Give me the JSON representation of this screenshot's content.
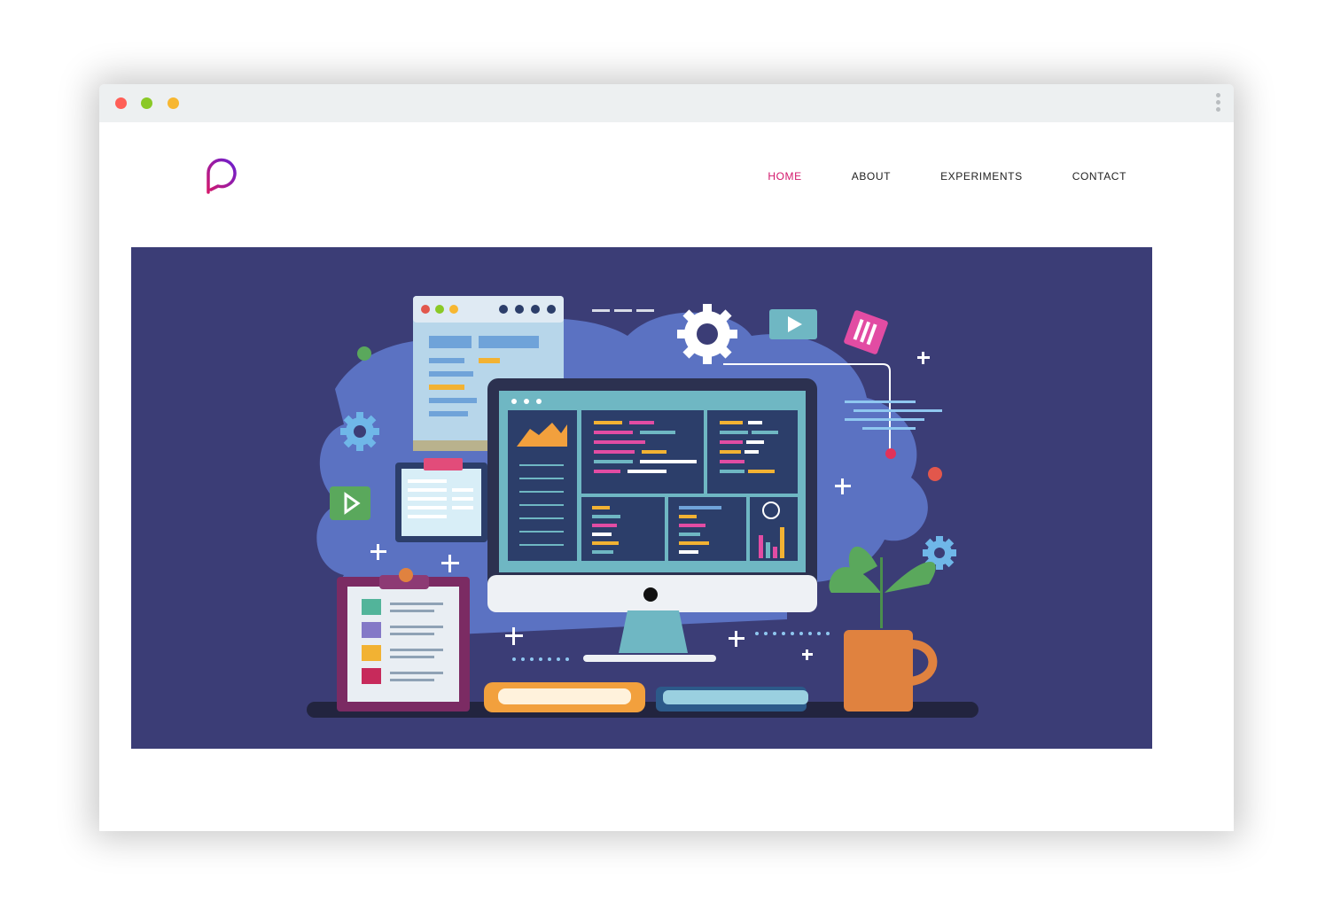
{
  "window": {
    "traffic_lights": {
      "close": "#ff5f57",
      "minimize": "#8ac926",
      "zoom": "#f7b731"
    },
    "menu_icon": "kebab-menu-icon"
  },
  "site": {
    "logo_icon": "speech-bubble-logo-icon",
    "logo_gradient": [
      "#d3186c",
      "#6a1fd1"
    ],
    "nav": [
      {
        "label": "HOME",
        "active": true
      },
      {
        "label": "ABOUT",
        "active": false
      },
      {
        "label": "EXPERIMENTS",
        "active": false
      },
      {
        "label": "CONTACT",
        "active": false
      }
    ],
    "accent": "#d3186c"
  },
  "hero": {
    "illustration": "developer-workspace-illustration",
    "background": "#3b3d76"
  }
}
